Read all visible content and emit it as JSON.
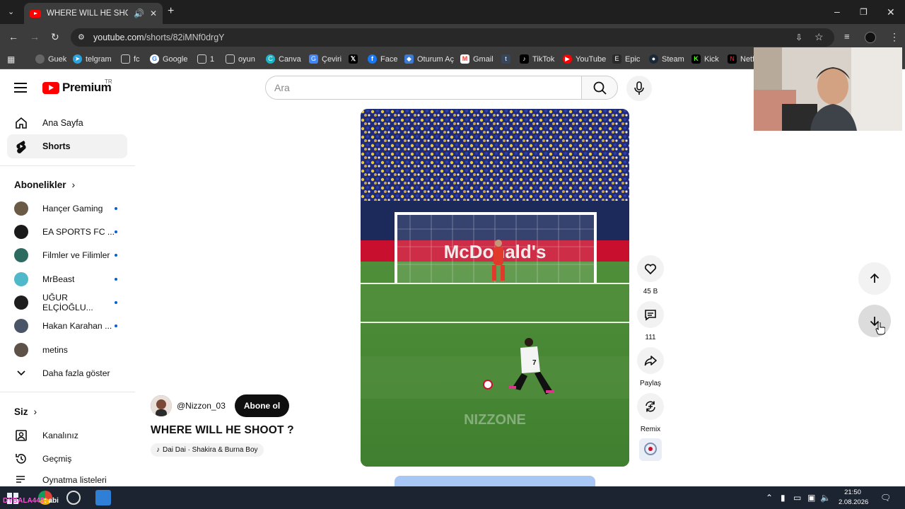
{
  "browser": {
    "tab_title": "WHERE WILL HE SHOOT ? - YouTube",
    "url_host": "youtube.com",
    "url_path": "/shorts/82iMNf0drgY",
    "bookmarks": [
      "Guek",
      "telgram",
      "fc",
      "Google",
      "1",
      "oyun",
      "Canva",
      "Çeviri",
      "",
      "Face",
      "Oturum Aç",
      "Gmail",
      "",
      "TikTok",
      "YouTube",
      "Epic",
      "Steam",
      "Kick",
      "Netfl"
    ]
  },
  "masthead": {
    "logo_text": "Premium",
    "logo_country": "TR",
    "search_placeholder": "Ara"
  },
  "sidebar": {
    "home": "Ana Sayfa",
    "shorts": "Shorts",
    "subscriptions_heading": "Abonelikler",
    "subscriptions": [
      {
        "name": "Hançer Gaming",
        "color": "#6b5a45"
      },
      {
        "name": "EA SPORTS FC ...",
        "color": "#1a1a1a"
      },
      {
        "name": "Filmler ve Filimler",
        "color": "#2d6a5f"
      },
      {
        "name": "MrBeast",
        "color": "#4fb8c9"
      },
      {
        "name": "UĞUR ELÇİOĞLU...",
        "color": "#1e1e1e"
      },
      {
        "name": "Hakan Karahan ...",
        "color": "#4a5568"
      },
      {
        "name": "metins",
        "color": "#5e5148"
      }
    ],
    "show_more": "Daha fazla göster",
    "you_heading": "Siz",
    "your_channel": "Kanalınız",
    "history": "Geçmiş",
    "playlists": "Oynatma listeleri"
  },
  "short": {
    "channel_handle": "@Nizzon_03",
    "subscribe_label": "Abone ol",
    "title": "WHERE WILL HE SHOOT ?",
    "music": "Dai Dai · Shakira & Burna Boy",
    "watermark": "NIZZONE",
    "ad_board": "McDonald's",
    "player_number": "7",
    "likes": "45 B",
    "comments": "111",
    "share_label": "Paylaş",
    "remix_label": "Remix"
  },
  "taskbar": {
    "time": "21:50",
    "date": "2.08.2026",
    "overlay_pink": "DYBALA4",
    "overlay_mid": "45",
    "overlay_white": ": abi"
  }
}
